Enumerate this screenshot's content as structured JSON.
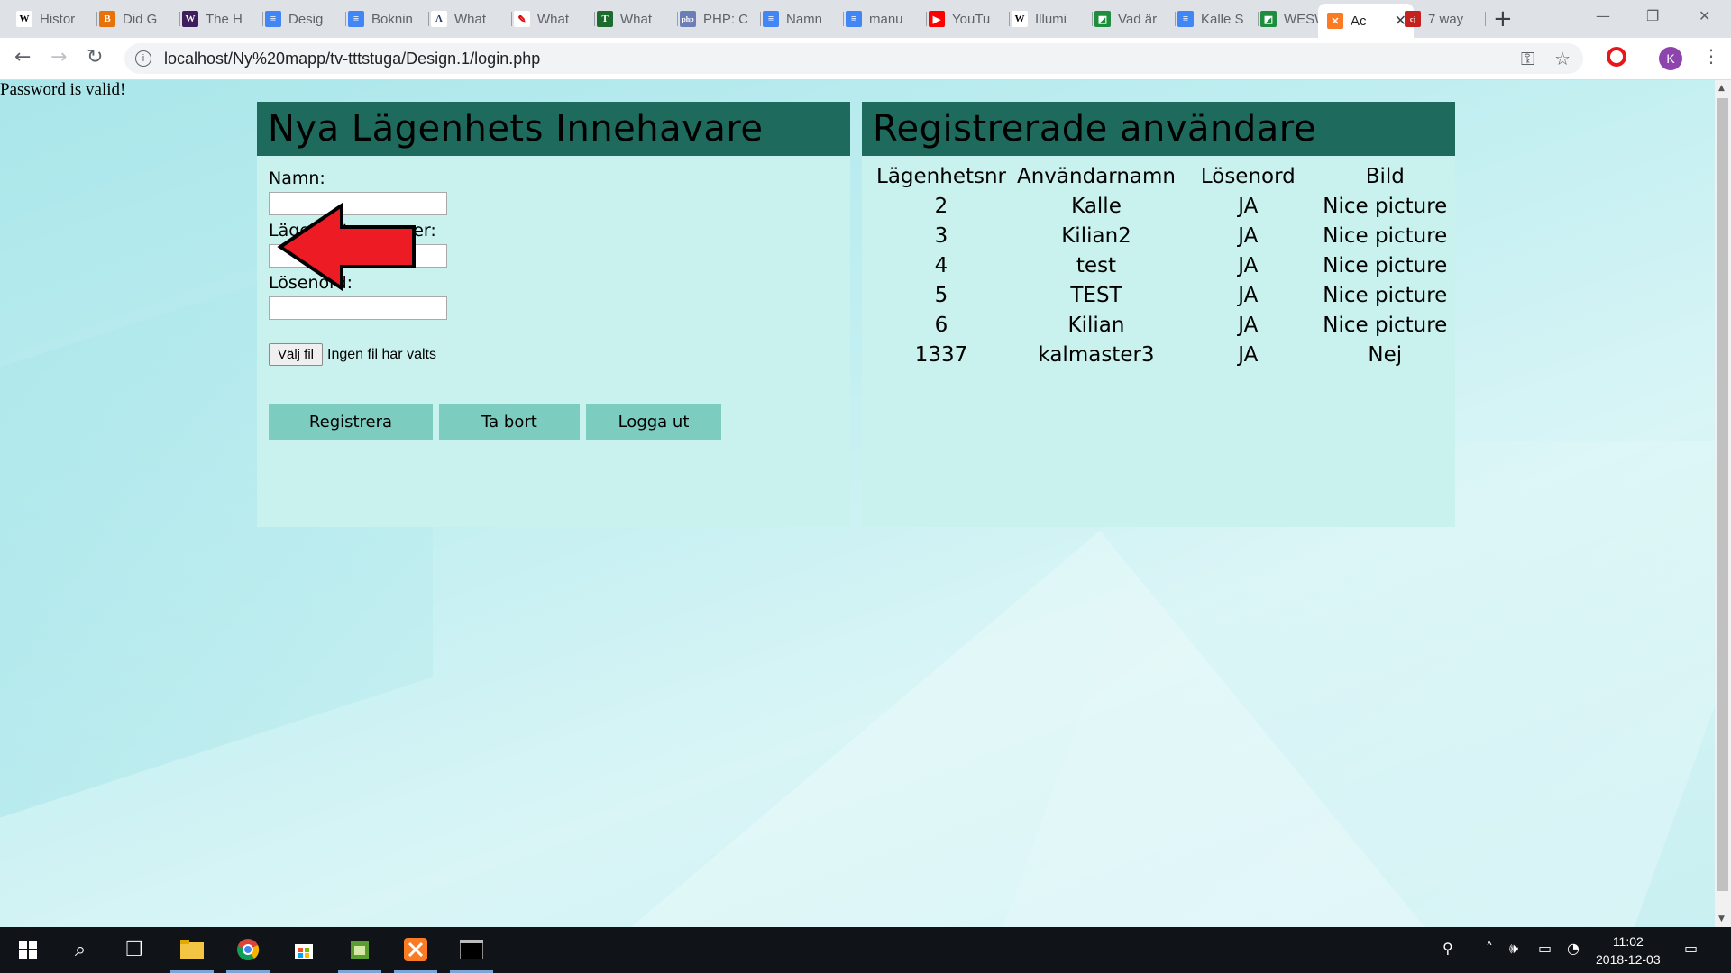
{
  "browser": {
    "tabs": [
      {
        "label": "Histor",
        "icon": "wikipedia-icon",
        "active": false
      },
      {
        "label": "Did G",
        "icon": "blogger-icon",
        "active": false
      },
      {
        "label": "The H",
        "icon": "w-icon",
        "active": false
      },
      {
        "label": "Desig",
        "icon": "docs-icon",
        "active": false
      },
      {
        "label": "Boknin",
        "icon": "docs-icon",
        "active": false
      },
      {
        "label": "What",
        "icon": "a-icon",
        "active": false
      },
      {
        "label": "What",
        "icon": "red-icon",
        "active": false
      },
      {
        "label": "What",
        "icon": "tc-icon",
        "active": false
      },
      {
        "label": "PHP: C",
        "icon": "php-icon",
        "active": false
      },
      {
        "label": "Namn",
        "icon": "docs-icon",
        "active": false
      },
      {
        "label": "manu",
        "icon": "docs-icon",
        "active": false
      },
      {
        "label": "YouTu",
        "icon": "youtube-icon",
        "active": false
      },
      {
        "label": "Illumi",
        "icon": "wikipedia-icon",
        "active": false
      },
      {
        "label": "Vad är",
        "icon": "classroom-icon",
        "active": false
      },
      {
        "label": "Kalle S",
        "icon": "docs-icon",
        "active": false
      },
      {
        "label": "WESW",
        "icon": "classroom-icon",
        "active": false
      },
      {
        "label": "Ac",
        "icon": "xampp-icon",
        "active": true
      },
      {
        "label": "7 way",
        "icon": "cj-icon",
        "active": false
      }
    ],
    "url": "localhost/Ny%20mapp/tv-tttstuga/Design.1/login.php",
    "avatar_letter": "K"
  },
  "page": {
    "status_text": "Password is valid!",
    "left_panel": {
      "title": "Nya Lägenhets Innehavare",
      "name_label": "Namn:",
      "name_value": "",
      "apartment_label": "Lägenhetsnummer:",
      "apartment_value": "",
      "password_label": "Lösenord:",
      "password_value": "",
      "file_button": "Välj fil",
      "file_status": "Ingen fil har valts",
      "register_button": "Registrera",
      "delete_button": "Ta bort",
      "logout_button": "Logga ut"
    },
    "right_panel": {
      "title": "Registrerade användare",
      "columns": [
        "Lägenhetsnr",
        "Användarnamn",
        "Lösenord",
        "Bild"
      ],
      "rows": [
        [
          "2",
          "Kalle",
          "JA",
          "Nice picture"
        ],
        [
          "3",
          "Kilian2",
          "JA",
          "Nice picture"
        ],
        [
          "4",
          "test",
          "JA",
          "Nice picture"
        ],
        [
          "5",
          "TEST",
          "JA",
          "Nice picture"
        ],
        [
          "6",
          "Kilian",
          "JA",
          "Nice picture"
        ],
        [
          "1337",
          "kalmaster3",
          "JA",
          "Nej"
        ]
      ]
    }
  },
  "taskbar": {
    "time": "11:02",
    "date": "2018-12-03"
  },
  "colors": {
    "panel_header": "#1e6b5e",
    "panel_bg": "#c9f2ee",
    "button_bg": "#7ccdbf",
    "arrow_fill": "#ed1c24"
  }
}
